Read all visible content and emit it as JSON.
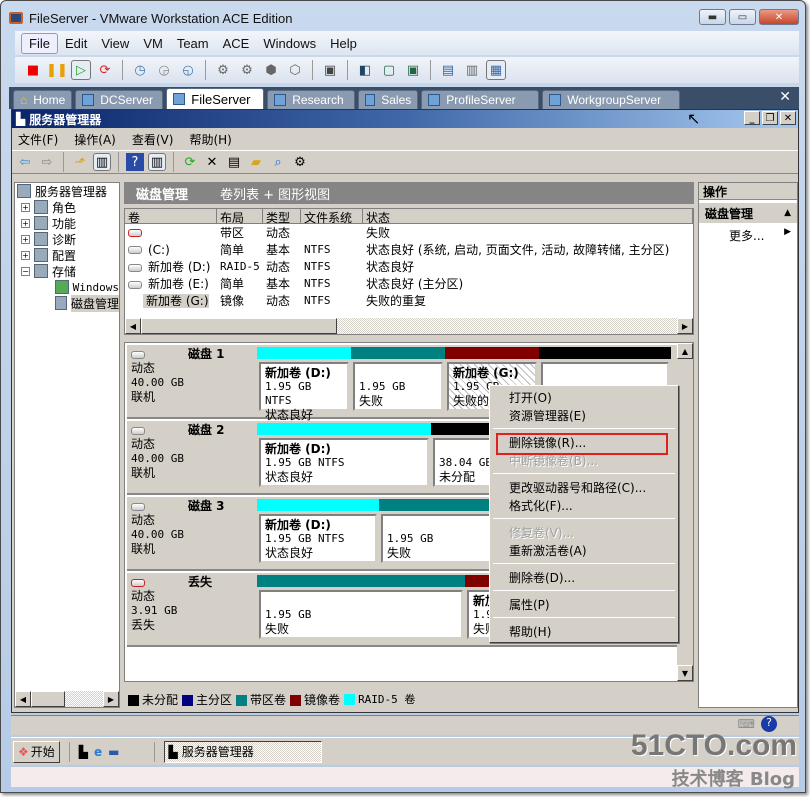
{
  "window": {
    "title": "FileServer - VMware Workstation ACE Edition"
  },
  "menubar": [
    "File",
    "Edit",
    "View",
    "VM",
    "Team",
    "ACE",
    "Windows",
    "Help"
  ],
  "tabs": [
    {
      "label": "Home",
      "icon": "home-icon"
    },
    {
      "label": "DCServer",
      "icon": "vm-icon"
    },
    {
      "label": "FileServer",
      "icon": "vm-icon",
      "active": true
    },
    {
      "label": "Research",
      "icon": "vm-icon"
    },
    {
      "label": "Sales",
      "icon": "vm-icon"
    },
    {
      "label": "ProfileServer",
      "icon": "vm-icon"
    },
    {
      "label": "WorkgroupServer",
      "icon": "vm-icon"
    }
  ],
  "mmc": {
    "title": "服务器管理器",
    "menu": [
      "文件(F)",
      "操作(A)",
      "查看(V)",
      "帮助(H)"
    ]
  },
  "tree": {
    "root": "服务器管理器",
    "items": [
      {
        "label": "角色",
        "expand": "+"
      },
      {
        "label": "功能",
        "expand": "+"
      },
      {
        "label": "诊断",
        "expand": "+"
      },
      {
        "label": "配置",
        "expand": "+"
      },
      {
        "label": "存储",
        "expand": "−"
      }
    ],
    "children": [
      "Windows",
      "磁盘管理"
    ]
  },
  "center": {
    "title": "磁盘管理",
    "subtitle": "卷列表 + 图形视图",
    "columns": [
      "卷",
      "布局",
      "类型",
      "文件系统",
      "状态"
    ],
    "rows": [
      {
        "vol": "",
        "layout": "带区",
        "type": "动态",
        "fs": "",
        "status": "失败",
        "err": true
      },
      {
        "vol": "(C:)",
        "layout": "简单",
        "type": "基本",
        "fs": "NTFS",
        "status": "状态良好 (系统, 启动, 页面文件, 活动, 故障转储, 主分区)"
      },
      {
        "vol": "新加卷 (D:)",
        "layout": "RAID-5",
        "type": "动态",
        "fs": "NTFS",
        "status": "状态良好"
      },
      {
        "vol": "新加卷 (E:)",
        "layout": "简单",
        "type": "基本",
        "fs": "NTFS",
        "status": "状态良好 (主分区)"
      },
      {
        "vol": "新加卷 (G:)",
        "layout": "镜像",
        "type": "动态",
        "fs": "NTFS",
        "status": "失败的重复"
      }
    ]
  },
  "disks": [
    {
      "name": "磁盘 1",
      "type": "动态",
      "size": "40.00 GB",
      "state": "联机",
      "parts": [
        {
          "color": "#00ffff",
          "label": "新加卷  (D:)",
          "size": "1.95 GB NTFS",
          "status": "状态良好"
        },
        {
          "color": "#008080",
          "label": "",
          "size": "1.95 GB",
          "status": "失败"
        },
        {
          "color": "#800000",
          "label": "新加卷  (G:)",
          "size": "1.95 GB",
          "status": "失败的重复",
          "hatch": true
        },
        {
          "color": "#000000",
          "label": "",
          "size": "",
          "status": ""
        }
      ]
    },
    {
      "name": "磁盘 2",
      "type": "动态",
      "size": "40.00 GB",
      "state": "联机",
      "parts": [
        {
          "color": "#00ffff",
          "label": "新加卷  (D:)",
          "size": "1.95 GB NTFS",
          "status": "状态良好"
        },
        {
          "color": "#000000",
          "label": "",
          "size": "38.04 GB",
          "status": "未分配"
        }
      ]
    },
    {
      "name": "磁盘 3",
      "type": "动态",
      "size": "40.00 GB",
      "state": "联机",
      "parts": [
        {
          "color": "#00ffff",
          "label": "新加卷  (D:)",
          "size": "1.95 GB NTFS",
          "status": "状态良好"
        },
        {
          "color": "#008080",
          "label": "",
          "size": "1.95 GB",
          "status": "失败"
        }
      ]
    },
    {
      "name": "丢失",
      "type": "动态",
      "size": "3.91 GB",
      "state": "丢失",
      "err": true,
      "parts": [
        {
          "color": "#008080",
          "label": "",
          "size": "1.95 GB",
          "status": "失败"
        },
        {
          "color": "#800000",
          "label": "新加卷",
          "size": "1.95 GB",
          "status": "失败"
        }
      ]
    }
  ],
  "legend": [
    {
      "label": "未分配",
      "color": "#000000"
    },
    {
      "label": "主分区",
      "color": "#000080"
    },
    {
      "label": "带区卷",
      "color": "#008080"
    },
    {
      "label": "镜像卷",
      "color": "#800000"
    },
    {
      "label": "RAID-5 卷",
      "color": "#00ffff"
    }
  ],
  "actions": {
    "header": "操作",
    "section": "磁盘管理",
    "more": "更多..."
  },
  "context_menu": [
    {
      "label": "打开(O)"
    },
    {
      "label": "资源管理器(E)"
    },
    {
      "sep": true
    },
    {
      "label": "删除镜像(R)...",
      "highlighted": true
    },
    {
      "label": "中断镜像卷(B)...",
      "disabled": true
    },
    {
      "sep": true
    },
    {
      "label": "更改驱动器号和路径(C)..."
    },
    {
      "label": "格式化(F)..."
    },
    {
      "sep": true
    },
    {
      "label": "修复卷(V)...",
      "disabled": true
    },
    {
      "label": "重新激活卷(A)"
    },
    {
      "sep": true
    },
    {
      "label": "删除卷(D)..."
    },
    {
      "sep": true
    },
    {
      "label": "属性(P)"
    },
    {
      "sep": true
    },
    {
      "label": "帮助(H)"
    }
  ],
  "taskbar": {
    "start": "开始",
    "task": "服务器管理器"
  },
  "watermark": {
    "site": "51CTO.com",
    "sub": "技术博客 Blog"
  }
}
